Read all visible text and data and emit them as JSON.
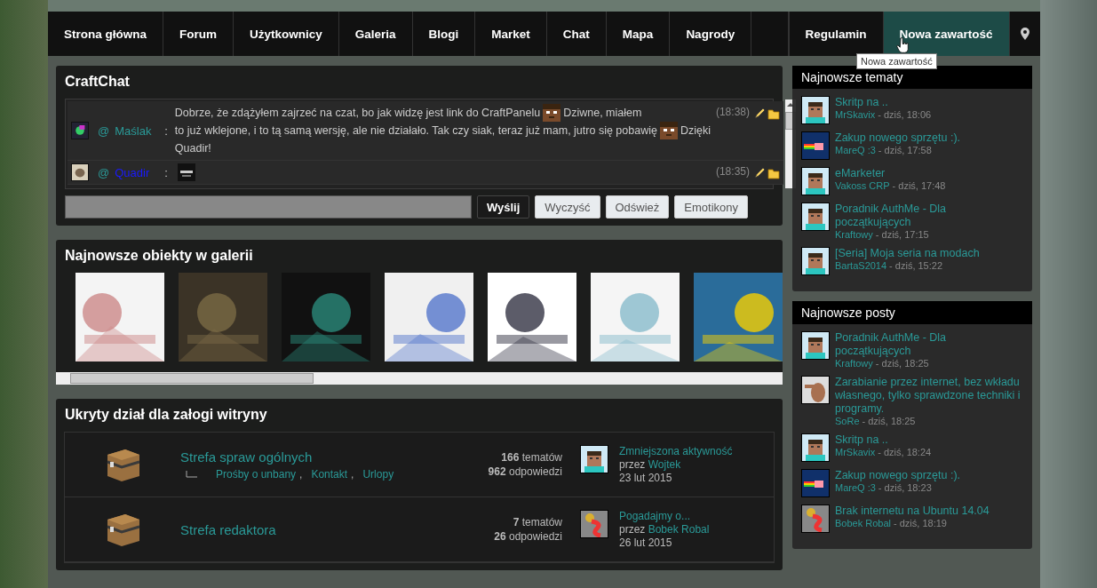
{
  "nav": [
    {
      "label": "Strona główna",
      "selected": false
    },
    {
      "label": "Forum",
      "selected": false
    },
    {
      "label": "Użytkownicy",
      "selected": false
    },
    {
      "label": "Galeria",
      "selected": false
    },
    {
      "label": "Blogi",
      "selected": false
    },
    {
      "label": "Market",
      "selected": false
    },
    {
      "label": "Chat",
      "selected": false
    },
    {
      "label": "Mapa",
      "selected": false
    },
    {
      "label": "Nagrody",
      "selected": false
    },
    {
      "label": "Regulamin",
      "selected": false
    },
    {
      "label": "Nowa zawartość",
      "selected": true
    }
  ],
  "tooltip": "Nowa zawartość",
  "chat": {
    "title": "CraftChat",
    "messages": [
      {
        "avatar": {
          "kind": "colorful"
        },
        "at": "@",
        "user": "Maślak",
        "color": "#2a9a98",
        "sep": ":",
        "lines": [
          [
            {
              "kind": "text",
              "text": "Dobrze, że zdążyłem zajrzeć na czat, bo jak widzę jest link do CraftPanelu"
            },
            {
              "kind": "emoticon"
            },
            {
              "kind": "text",
              "text": "Dziwne, miałem"
            }
          ],
          [
            {
              "kind": "text",
              "text": "to już wklejone, i to tą samą wersję, ale nie działało. Tak czy siak, teraz już mam, jutro się pobawię"
            },
            {
              "kind": "emoticon"
            },
            {
              "kind": "text",
              "text": "Dzięki"
            }
          ],
          [
            {
              "kind": "text",
              "text": "Quadir!"
            }
          ]
        ],
        "time": "(18:38)"
      },
      {
        "avatar": {
          "kind": "seal"
        },
        "at": "@",
        "user": "Quadir",
        "color": "#1a1aff",
        "sep": ":",
        "lines": [
          [
            {
              "kind": "emoticon-dark"
            }
          ]
        ],
        "time": "(18:35)"
      }
    ],
    "buttons": [
      "Wyślij",
      "Wyczyść",
      "Odśwież",
      "Emotikony"
    ]
  },
  "gallery": {
    "title": "Najnowsze obiekty w galerii"
  },
  "forum": {
    "title": "Ukryty dział dla załogi witryny",
    "rows": [
      {
        "title": "Strefa spraw ogólnych",
        "subforums": [
          {
            "label": "Prośby o unbany",
            "sep": ","
          },
          {
            "label": "Kontakt",
            "sep": ","
          },
          {
            "label": "Urlopy"
          }
        ],
        "topics": "**166** tematów",
        "replies": "**962** odpowiedzi",
        "last_title": "Zmniejszona aktywność",
        "by": "przez",
        "last_user": "Wojtek",
        "date": "23 lut 2015",
        "avatar": {
          "kind": "steve"
        }
      },
      {
        "title": "Strefa redaktora",
        "topics": "**7** tematów",
        "replies": "**26** odpowiedzi",
        "last_title": "Pogadajmy o...",
        "by": "przez",
        "last_user": "Bobek Robal",
        "date": "26 lut 2015",
        "avatar": {
          "kind": "worm"
        }
      }
    ]
  },
  "sidebar": [
    {
      "title": "Najnowsze tematy",
      "items": [
        {
          "title": "Skritp na ..",
          "user": "MrSkavix",
          "time": "- dziś, 18:06",
          "avatar": {
            "kind": "steve"
          }
        },
        {
          "title": "Zakup nowego sprzętu :).",
          "user": "MareQ :3",
          "time": "- dziś, 17:58",
          "avatar": {
            "kind": "nyan"
          }
        },
        {
          "title": "eMarketer",
          "user": "Vakoss CRP",
          "time": "- dziś, 17:48",
          "avatar": {
            "kind": "steve"
          }
        },
        {
          "title": "Poradnik AuthMe - Dla początkujących",
          "user": "Kraftowy",
          "time": "- dziś, 17:15",
          "avatar": {
            "kind": "steve"
          }
        },
        {
          "title": "[Seria] Moja seria na modach",
          "user": "BartaS2014",
          "time": "- dziś, 15:22",
          "avatar": {
            "kind": "steve"
          }
        }
      ]
    },
    {
      "title": "Najnowsze posty",
      "items": [
        {
          "title": "Poradnik AuthMe - Dla początkujących",
          "user": "Kraftowy",
          "time": "- dziś, 18:25",
          "avatar": {
            "kind": "steve"
          }
        },
        {
          "title": "Zarabianie przez internet, bez wkładu własnego, tylko sprawdzone techniki i programy.",
          "user": "SoRe",
          "time": "- dziś, 18:25"
        },
        {
          "title": "Skritp na ..",
          "user": "MrSkavix",
          "time": "- dziś, 18:24",
          "avatar": {
            "kind": "steve"
          }
        },
        {
          "title": "Zakup nowego sprzętu :).",
          "user": "MareQ :3",
          "time": "- dziś, 18:23",
          "avatar": {
            "kind": "nyan"
          }
        },
        {
          "title": "Brak internetu na Ubuntu 14.04",
          "user": "Bobek Robal",
          "time": "- dziś, 18:19",
          "avatar": {
            "kind": "worm"
          }
        }
      ]
    }
  ]
}
